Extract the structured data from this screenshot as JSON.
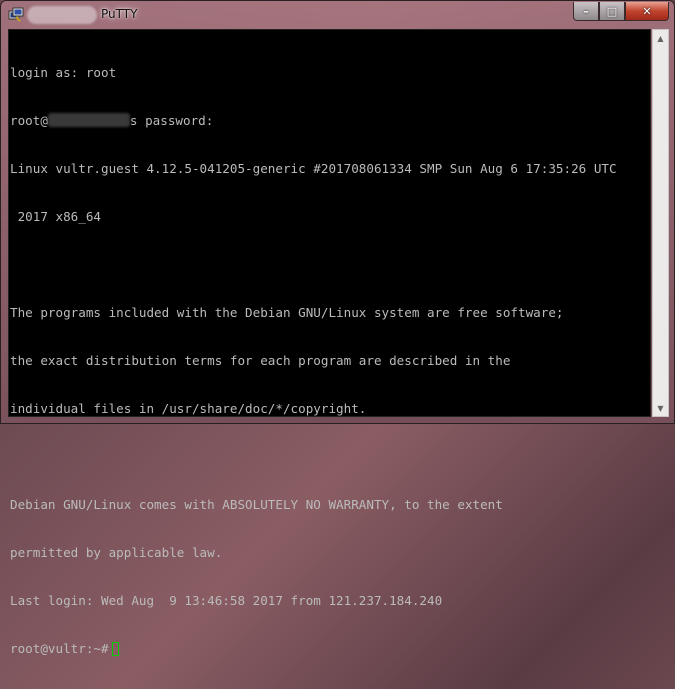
{
  "window": {
    "title": "PuTTY",
    "icon": "putty-icon"
  },
  "controls": {
    "minimize": "–",
    "maximize": "□",
    "close": "✕"
  },
  "terminal": {
    "lines": [
      "login as: root",
      "root@",
      "s password:",
      "Linux vultr.guest 4.12.5-041205-generic #201708061334 SMP Sun Aug 6 17:35:26 UTC",
      " 2017 x86_64",
      "",
      "The programs included with the Debian GNU/Linux system are free software;",
      "the exact distribution terms for each program are described in the",
      "individual files in /usr/share/doc/*/copyright.",
      "",
      "Debian GNU/Linux comes with ABSOLUTELY NO WARRANTY, to the extent",
      "permitted by applicable law.",
      "Last login: Wed Aug  9 13:46:58 2017 from 121.237.184.240",
      "root@vultr:~#"
    ],
    "text_color": "#bbbbbb",
    "cursor_color": "#00d000"
  },
  "scrollbar": {
    "up_arrow": "▲",
    "down_arrow": "▼"
  }
}
